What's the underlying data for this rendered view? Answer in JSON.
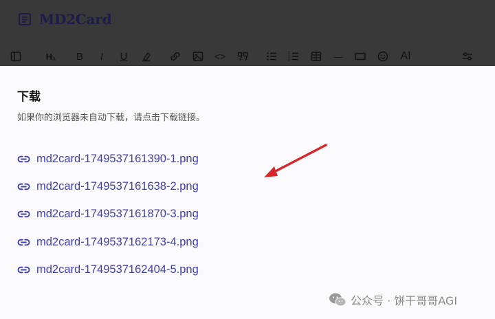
{
  "app": {
    "name": "MD2Card",
    "logo_icon": "notebook-icon"
  },
  "toolbar": {
    "items": [
      {
        "name": "sidebar-toggle-icon",
        "text": ""
      },
      {
        "name": "heading-icon",
        "text": "H₁"
      },
      {
        "name": "bold-icon",
        "text": "B"
      },
      {
        "name": "italic-icon",
        "text": "I"
      },
      {
        "name": "underline-icon",
        "text": "U"
      },
      {
        "name": "strikethrough-icon",
        "text": ""
      },
      {
        "name": "link-icon",
        "text": ""
      },
      {
        "name": "image-icon",
        "text": ""
      },
      {
        "name": "code-icon",
        "text": "<>"
      },
      {
        "name": "quote-icon",
        "text": ""
      },
      {
        "name": "bullet-list-icon",
        "text": ""
      },
      {
        "name": "numbered-list-icon",
        "text": ""
      },
      {
        "name": "table-icon",
        "text": ""
      },
      {
        "name": "horizontal-rule-icon",
        "text": "—"
      },
      {
        "name": "frame-icon",
        "text": ""
      },
      {
        "name": "emoji-icon",
        "text": ""
      },
      {
        "name": "ai-icon",
        "text": "AI"
      },
      {
        "name": "settings-sliders-icon",
        "text": ""
      }
    ]
  },
  "download": {
    "title": "下载",
    "description": "如果你的浏览器未自动下载，请点击下载链接。",
    "files": [
      "md2card-1749537161390-1.png",
      "md2card-1749537161638-2.png",
      "md2card-1749537161870-3.png",
      "md2card-1749537162173-4.png",
      "md2card-1749537162404-5.png"
    ]
  },
  "watermark": {
    "text": "公众号 · 饼干哥哥AGI",
    "icon": "wechat-icon"
  },
  "colors": {
    "topbar": "#393939",
    "link": "#3f3fb3",
    "arrow": "#d9262b",
    "logo": "#1e1b4b"
  }
}
